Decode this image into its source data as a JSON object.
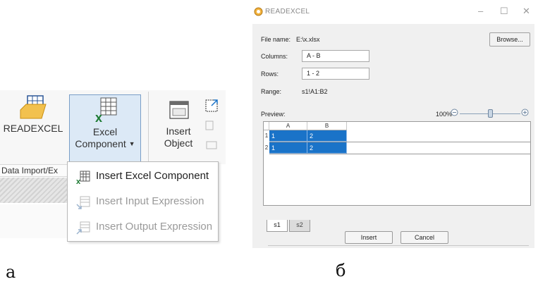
{
  "panel_a": {
    "ribbon": {
      "readexcel_label": "READEXCEL",
      "excel_component_line1": "Excel",
      "excel_component_line2": "Component",
      "insert_object_line1": "Insert",
      "insert_object_line2": "Object",
      "group_label": "Data Import/Ex"
    },
    "menu": {
      "items": [
        {
          "label": "Insert Excel Component",
          "enabled": true,
          "icon": "excel-component-icon"
        },
        {
          "label": "Insert Input Expression",
          "enabled": false,
          "icon": "input-expression-icon"
        },
        {
          "label": "Insert Output Expression",
          "enabled": false,
          "icon": "output-expression-icon"
        }
      ]
    },
    "caption": "a"
  },
  "panel_b": {
    "title": "READEXCEL",
    "window_controls": {
      "minimize": "–",
      "maximize": "☐",
      "close": "✕"
    },
    "fields": {
      "file_name_label": "File name:",
      "file_name_value": "E:\\x.xlsx",
      "columns_label": "Columns:",
      "columns_value": "A - B",
      "rows_label": "Rows:",
      "rows_value": "1 - 2",
      "range_label": "Range:",
      "range_value": "s1!A1:B2",
      "preview_label": "Preview:"
    },
    "browse_label": "Browse...",
    "zoom": {
      "text": "100%",
      "minus": "−",
      "plus": "+",
      "level": 0.5
    },
    "grid": {
      "columns": [
        "A",
        "B"
      ],
      "rows": [
        {
          "num": "1",
          "cells": [
            "1",
            "2"
          ]
        },
        {
          "num": "2",
          "cells": [
            "1",
            "2"
          ]
        }
      ]
    },
    "sheet_tabs": [
      "s1",
      "s2"
    ],
    "insert_label": "Insert",
    "cancel_label": "Cancel",
    "caption": "б"
  },
  "colors": {
    "selection": "#1a73c8",
    "excel_green": "#1e7b34",
    "accent_orange": "#f0a030",
    "button_highlight": "#dce9f6"
  }
}
